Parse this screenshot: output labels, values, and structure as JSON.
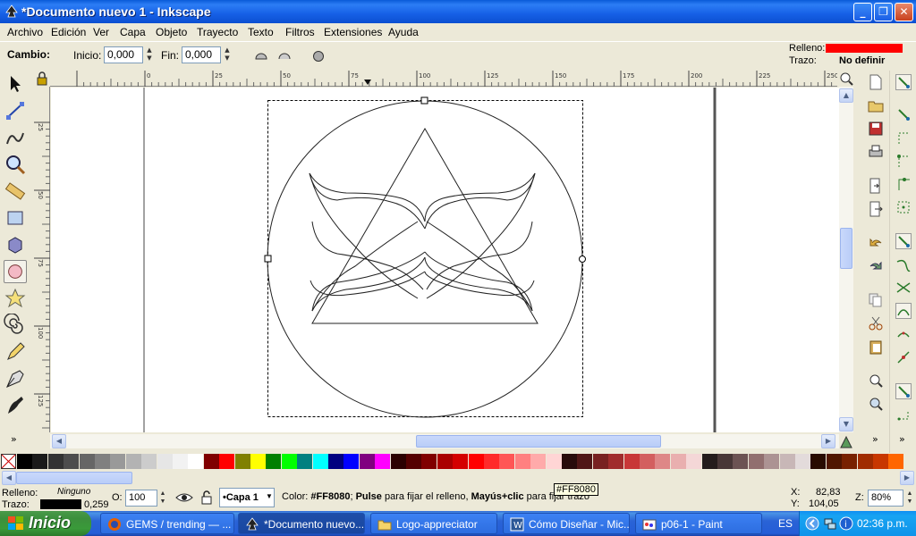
{
  "window": {
    "title": "*Documento nuevo 1 - Inkscape",
    "minimize": "_",
    "maximize": "❐",
    "close": "✕"
  },
  "menu": [
    "Archivo",
    "Edición",
    "Ver",
    "Capa",
    "Objeto",
    "Trayecto",
    "Texto",
    "Filtros",
    "Extensiones",
    "Ayuda"
  ],
  "controls": {
    "change_label": "Cambio:",
    "start_label": "Inicio:",
    "start_value": "0,000",
    "end_label": "Fin:",
    "end_value": "0,000"
  },
  "style_indicator": {
    "fill_label": "Relleno:",
    "fill_color": "#FF0000",
    "stroke_label": "Trazo:",
    "stroke_value": "No definir"
  },
  "ruler": {
    "h_ticks": [
      "-50",
      "0",
      "25",
      "50",
      "75",
      "100",
      "125",
      "150",
      "175",
      "200",
      "225",
      "250"
    ],
    "v_ticks": [
      "25",
      "50",
      "75",
      "100",
      "125",
      "150"
    ]
  },
  "palette": [
    "#000000",
    "#1a1a1a",
    "#333333",
    "#4d4d4d",
    "#666666",
    "#808080",
    "#999999",
    "#b3b3b3",
    "#cccccc",
    "#e6e6e6",
    "#f2f2f2",
    "#ffffff",
    "#800000",
    "#ff0000",
    "#808000",
    "#ffff00",
    "#008000",
    "#00ff00",
    "#008080",
    "#00ffff",
    "#000080",
    "#0000ff",
    "#800080",
    "#ff00ff",
    "#2b0000",
    "#550000",
    "#800000",
    "#aa0000",
    "#d40000",
    "#ff0000",
    "#ff2a2a",
    "#ff5555",
    "#ff8080",
    "#ffaaaa",
    "#ffd5d5",
    "#280b0b",
    "#501616",
    "#782121",
    "#a02c2c",
    "#c83737",
    "#d35f5f",
    "#de8787",
    "#e9afaf",
    "#f4d7d7",
    "#241c1c",
    "#483737",
    "#6c5353",
    "#916f6f",
    "#ac9393",
    "#c8b7b7",
    "#e3dbdb",
    "#280b00",
    "#501600",
    "#782100",
    "#a02c00",
    "#c83700",
    "#ff6600"
  ],
  "status": {
    "fill_label": "Relleno:",
    "fill_value": "Ninguno",
    "stroke_label": "Trazo:",
    "stroke_width": "0,259",
    "opacity_label": "O:",
    "opacity_value": "100",
    "layer": "•Capa 1",
    "message_prefix": "Color: ",
    "message_color": "#FF8080",
    "message_mid": "; ",
    "message_pulse": "Pulse",
    "message_text1": " para fijar el relleno, ",
    "message_shift": "Mayús+clic",
    "message_text2": " para fijar trazo",
    "tooltip": "#FF8080",
    "x_label": "X:",
    "x_value": "82,83",
    "y_label": "Y:",
    "y_value": "104,05",
    "zoom_label": "Z:",
    "zoom_value": "80%"
  },
  "taskbar": {
    "start": "Inicio",
    "tasks": [
      "GEMS / trending — ...",
      "*Documento nuevo...",
      "Logo-appreciator",
      "Cómo Diseñar - Mic...",
      "p06-1 - Paint"
    ],
    "lang": "ES",
    "clock": "02:36 p.m."
  }
}
